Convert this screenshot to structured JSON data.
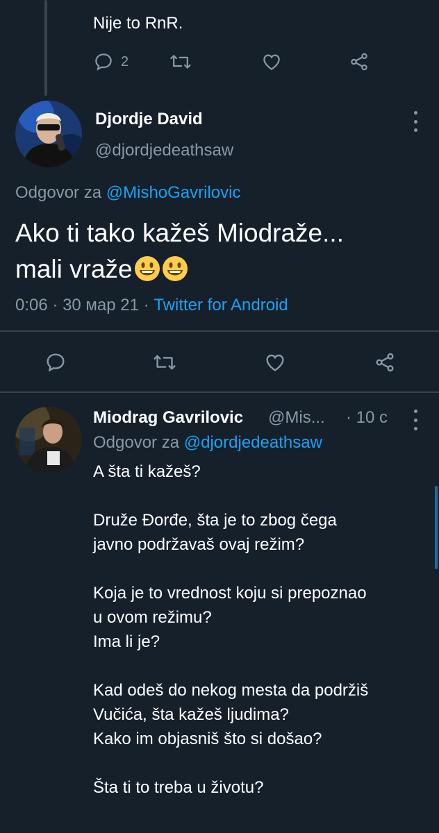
{
  "prev_tweet": {
    "text": "Nije to RnR.",
    "reply_count": "2"
  },
  "main_tweet": {
    "name": "Djordje David",
    "handle": "@djordjedeathsaw",
    "reply_prefix": "Odgovor za",
    "reply_mention": "@MishoGavrilovic",
    "text_line1": "Ako ti tako kažeš Miodraže...",
    "text_line2": "mali vraže",
    "time": "0:06",
    "date": "30 мар 21",
    "client": "Twitter for Android",
    "sep": "·"
  },
  "reply_tweet": {
    "name": "Miodrag Gavrilovic",
    "handle": "@Mis...",
    "time_ago": "10 c",
    "reply_prefix": "Odgovor za",
    "reply_mention": "@djordjedeathsaw",
    "lines": [
      "A šta ti kažeš?",
      "",
      "Druže Đorđe, šta je to zbog čega",
      "javno podržavaš ovaj režim?",
      "",
      "Koja je to vrednost koju si prepoznao",
      "u ovom režimu?",
      "Ima li je?",
      "",
      "Kad odeš do nekog mesta da podržiš",
      "Vučića, šta kažeš ljudima?",
      "Kako im objasniš što si došao?",
      "",
      "Šta ti to treba u životu?"
    ]
  },
  "colors": {
    "background": "#15202b",
    "secondary_text": "#8899a6",
    "accent": "#1da1f2",
    "divider": "#38444d"
  },
  "icons": [
    "reply-icon",
    "retweet-icon",
    "like-icon",
    "share-icon",
    "more-icon",
    "emoji-grinning-icon"
  ]
}
